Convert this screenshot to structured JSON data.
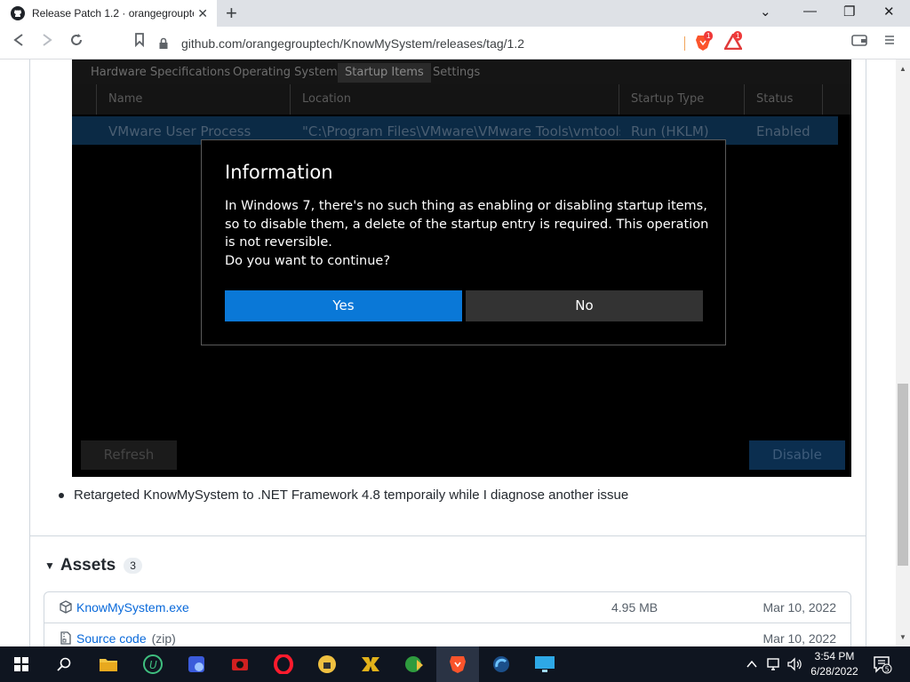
{
  "browser": {
    "tab_title": "Release Patch 1.2 · orangegroupte",
    "url": "github.com/orangegrouptech/KnowMySystem/releases/tag/1.2",
    "brave_badge": "1",
    "rewards_badge": "1"
  },
  "app": {
    "tabs": [
      "Hardware Specifications",
      "Operating System",
      "Startup Items",
      "Settings"
    ],
    "columns": [
      "Name",
      "Location",
      "Startup Type",
      "Status"
    ],
    "row": {
      "name": "VMware User Process",
      "location": "\"C:\\Program Files\\VMware\\VMware Tools\\vmtoolsd.e",
      "startup_type": "Run (HKLM)",
      "status": "Enabled"
    },
    "refresh_label": "Refresh",
    "disable_label": "Disable"
  },
  "dialog": {
    "title": "Information",
    "body": "In Windows 7, there's no such thing as enabling or disabling startup items, so to disable them, a delete of the startup entry is required. This operation is not reversible.",
    "question": "Do you want to continue?",
    "yes_label": "Yes",
    "no_label": "No"
  },
  "notes": {
    "item": "Retargeted KnowMySystem to .NET Framework 4.8 temporaily while I diagnose another issue"
  },
  "assets": {
    "title": "Assets",
    "count": "3",
    "items": [
      {
        "name": "KnowMySystem.exe",
        "sub": "",
        "size": "4.95 MB",
        "date": "Mar 10, 2022"
      },
      {
        "name": "Source code",
        "sub": "(zip)",
        "size": "",
        "date": "Mar 10, 2022"
      }
    ]
  },
  "taskbar": {
    "time": "3:54 PM",
    "date": "6/28/2022",
    "notif_count": "5"
  }
}
